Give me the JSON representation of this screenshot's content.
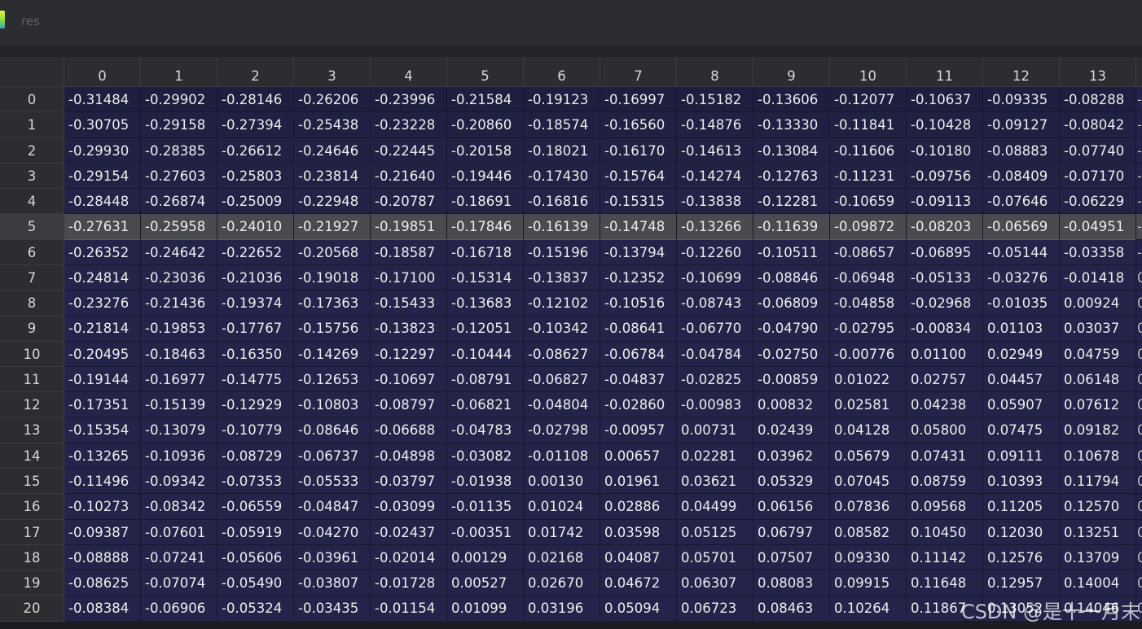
{
  "window": {
    "title": "res"
  },
  "columns": [
    "0",
    "1",
    "2",
    "3",
    "4",
    "5",
    "6",
    "7",
    "8",
    "9",
    "10",
    "11",
    "12",
    "13"
  ],
  "selected_row": 5,
  "rows": [
    {
      "index": "0",
      "values": [
        "-0.31484",
        "-0.29902",
        "-0.28146",
        "-0.26206",
        "-0.23996",
        "-0.21584",
        "-0.19123",
        "-0.16997",
        "-0.15182",
        "-0.13606",
        "-0.12077",
        "-0.10637",
        "-0.09335",
        "-0.08288"
      ],
      "edge": "-"
    },
    {
      "index": "1",
      "values": [
        "-0.30705",
        "-0.29158",
        "-0.27394",
        "-0.25438",
        "-0.23228",
        "-0.20860",
        "-0.18574",
        "-0.16560",
        "-0.14876",
        "-0.13330",
        "-0.11841",
        "-0.10428",
        "-0.09127",
        "-0.08042"
      ],
      "edge": "-"
    },
    {
      "index": "2",
      "values": [
        "-0.29930",
        "-0.28385",
        "-0.26612",
        "-0.24646",
        "-0.22445",
        "-0.20158",
        "-0.18021",
        "-0.16170",
        "-0.14613",
        "-0.13084",
        "-0.11606",
        "-0.10180",
        "-0.08883",
        "-0.07740"
      ],
      "edge": "-"
    },
    {
      "index": "3",
      "values": [
        "-0.29154",
        "-0.27603",
        "-0.25803",
        "-0.23814",
        "-0.21640",
        "-0.19446",
        "-0.17430",
        "-0.15764",
        "-0.14274",
        "-0.12763",
        "-0.11231",
        "-0.09756",
        "-0.08409",
        "-0.07170"
      ],
      "edge": "-"
    },
    {
      "index": "4",
      "values": [
        "-0.28448",
        "-0.26874",
        "-0.25009",
        "-0.22948",
        "-0.20787",
        "-0.18691",
        "-0.16816",
        "-0.15315",
        "-0.13838",
        "-0.12281",
        "-0.10659",
        "-0.09113",
        "-0.07646",
        "-0.06229"
      ],
      "edge": "-"
    },
    {
      "index": "5",
      "values": [
        "-0.27631",
        "-0.25958",
        "-0.24010",
        "-0.21927",
        "-0.19851",
        "-0.17846",
        "-0.16139",
        "-0.14748",
        "-0.13266",
        "-0.11639",
        "-0.09872",
        "-0.08203",
        "-0.06569",
        "-0.04951"
      ],
      "edge": "-"
    },
    {
      "index": "6",
      "values": [
        "-0.26352",
        "-0.24642",
        "-0.22652",
        "-0.20568",
        "-0.18587",
        "-0.16718",
        "-0.15196",
        "-0.13794",
        "-0.12260",
        "-0.10511",
        "-0.08657",
        "-0.06895",
        "-0.05144",
        "-0.03358"
      ],
      "edge": "-"
    },
    {
      "index": "7",
      "values": [
        "-0.24814",
        "-0.23036",
        "-0.21036",
        "-0.19018",
        "-0.17100",
        "-0.15314",
        "-0.13837",
        "-0.12352",
        "-0.10699",
        "-0.08846",
        "-0.06948",
        "-0.05133",
        "-0.03276",
        "-0.01418"
      ],
      "edge": "0"
    },
    {
      "index": "8",
      "values": [
        "-0.23276",
        "-0.21436",
        "-0.19374",
        "-0.17363",
        "-0.15433",
        "-0.13683",
        "-0.12102",
        "-0.10516",
        "-0.08743",
        "-0.06809",
        "-0.04858",
        "-0.02968",
        "-0.01035",
        "0.00924"
      ],
      "edge": "0"
    },
    {
      "index": "9",
      "values": [
        "-0.21814",
        "-0.19853",
        "-0.17767",
        "-0.15756",
        "-0.13823",
        "-0.12051",
        "-0.10342",
        "-0.08641",
        "-0.06770",
        "-0.04790",
        "-0.02795",
        "-0.00834",
        "0.01103",
        "0.03037"
      ],
      "edge": "0"
    },
    {
      "index": "10",
      "values": [
        "-0.20495",
        "-0.18463",
        "-0.16350",
        "-0.14269",
        "-0.12297",
        "-0.10444",
        "-0.08627",
        "-0.06784",
        "-0.04784",
        "-0.02750",
        "-0.00776",
        "0.01100",
        "0.02949",
        "0.04759"
      ],
      "edge": "0"
    },
    {
      "index": "11",
      "values": [
        "-0.19144",
        "-0.16977",
        "-0.14775",
        "-0.12653",
        "-0.10697",
        "-0.08791",
        "-0.06827",
        "-0.04837",
        "-0.02825",
        "-0.00859",
        "0.01022",
        "0.02757",
        "0.04457",
        "0.06148"
      ],
      "edge": "0"
    },
    {
      "index": "12",
      "values": [
        "-0.17351",
        "-0.15139",
        "-0.12929",
        "-0.10803",
        "-0.08797",
        "-0.06821",
        "-0.04804",
        "-0.02860",
        "-0.00983",
        "0.00832",
        "0.02581",
        "0.04238",
        "0.05907",
        "0.07612"
      ],
      "edge": "0"
    },
    {
      "index": "13",
      "values": [
        "-0.15354",
        "-0.13079",
        "-0.10779",
        "-0.08646",
        "-0.06688",
        "-0.04783",
        "-0.02798",
        "-0.00957",
        "0.00731",
        "0.02439",
        "0.04128",
        "0.05800",
        "0.07475",
        "0.09182"
      ],
      "edge": "0"
    },
    {
      "index": "14",
      "values": [
        "-0.13265",
        "-0.10936",
        "-0.08729",
        "-0.06737",
        "-0.04898",
        "-0.03082",
        "-0.01108",
        "0.00657",
        "0.02281",
        "0.03962",
        "0.05679",
        "0.07431",
        "0.09111",
        "0.10678"
      ],
      "edge": "0"
    },
    {
      "index": "15",
      "values": [
        "-0.11496",
        "-0.09342",
        "-0.07353",
        "-0.05533",
        "-0.03797",
        "-0.01938",
        "0.00130",
        "0.01961",
        "0.03621",
        "0.05329",
        "0.07045",
        "0.08759",
        "0.10393",
        "0.11794"
      ],
      "edge": "0"
    },
    {
      "index": "16",
      "values": [
        "-0.10273",
        "-0.08342",
        "-0.06559",
        "-0.04847",
        "-0.03099",
        "-0.01135",
        "0.01024",
        "0.02886",
        "0.04499",
        "0.06156",
        "0.07836",
        "0.09568",
        "0.11205",
        "0.12570"
      ],
      "edge": "0"
    },
    {
      "index": "17",
      "values": [
        "-0.09387",
        "-0.07601",
        "-0.05919",
        "-0.04270",
        "-0.02437",
        "-0.00351",
        "0.01742",
        "0.03598",
        "0.05125",
        "0.06797",
        "0.08582",
        "0.10450",
        "0.12030",
        "0.13251"
      ],
      "edge": "0"
    },
    {
      "index": "18",
      "values": [
        "-0.08888",
        "-0.07241",
        "-0.05606",
        "-0.03961",
        "-0.02014",
        "0.00129",
        "0.02168",
        "0.04087",
        "0.05701",
        "0.07507",
        "0.09330",
        "0.11142",
        "0.12576",
        "0.13709"
      ],
      "edge": "0"
    },
    {
      "index": "19",
      "values": [
        "-0.08625",
        "-0.07074",
        "-0.05490",
        "-0.03807",
        "-0.01728",
        "0.00527",
        "0.02670",
        "0.04672",
        "0.06307",
        "0.08083",
        "0.09915",
        "0.11648",
        "0.12957",
        "0.14004"
      ],
      "edge": "0"
    },
    {
      "index": "20",
      "values": [
        "-0.08384",
        "-0.06906",
        "-0.05324",
        "-0.03435",
        "-0.01154",
        "0.01099",
        "0.03196",
        "0.05094",
        "0.06723",
        "0.08463",
        "0.10264",
        "0.11867",
        "0.13052",
        "0.14046"
      ],
      "edge": "0"
    }
  ],
  "watermark": "CSDN @是十一月末",
  "colors": {
    "cell_bg": "#24244a",
    "header_bg": "#2b2d30",
    "selected_bg": "#4a4b4f",
    "text": "#eeeeee"
  }
}
